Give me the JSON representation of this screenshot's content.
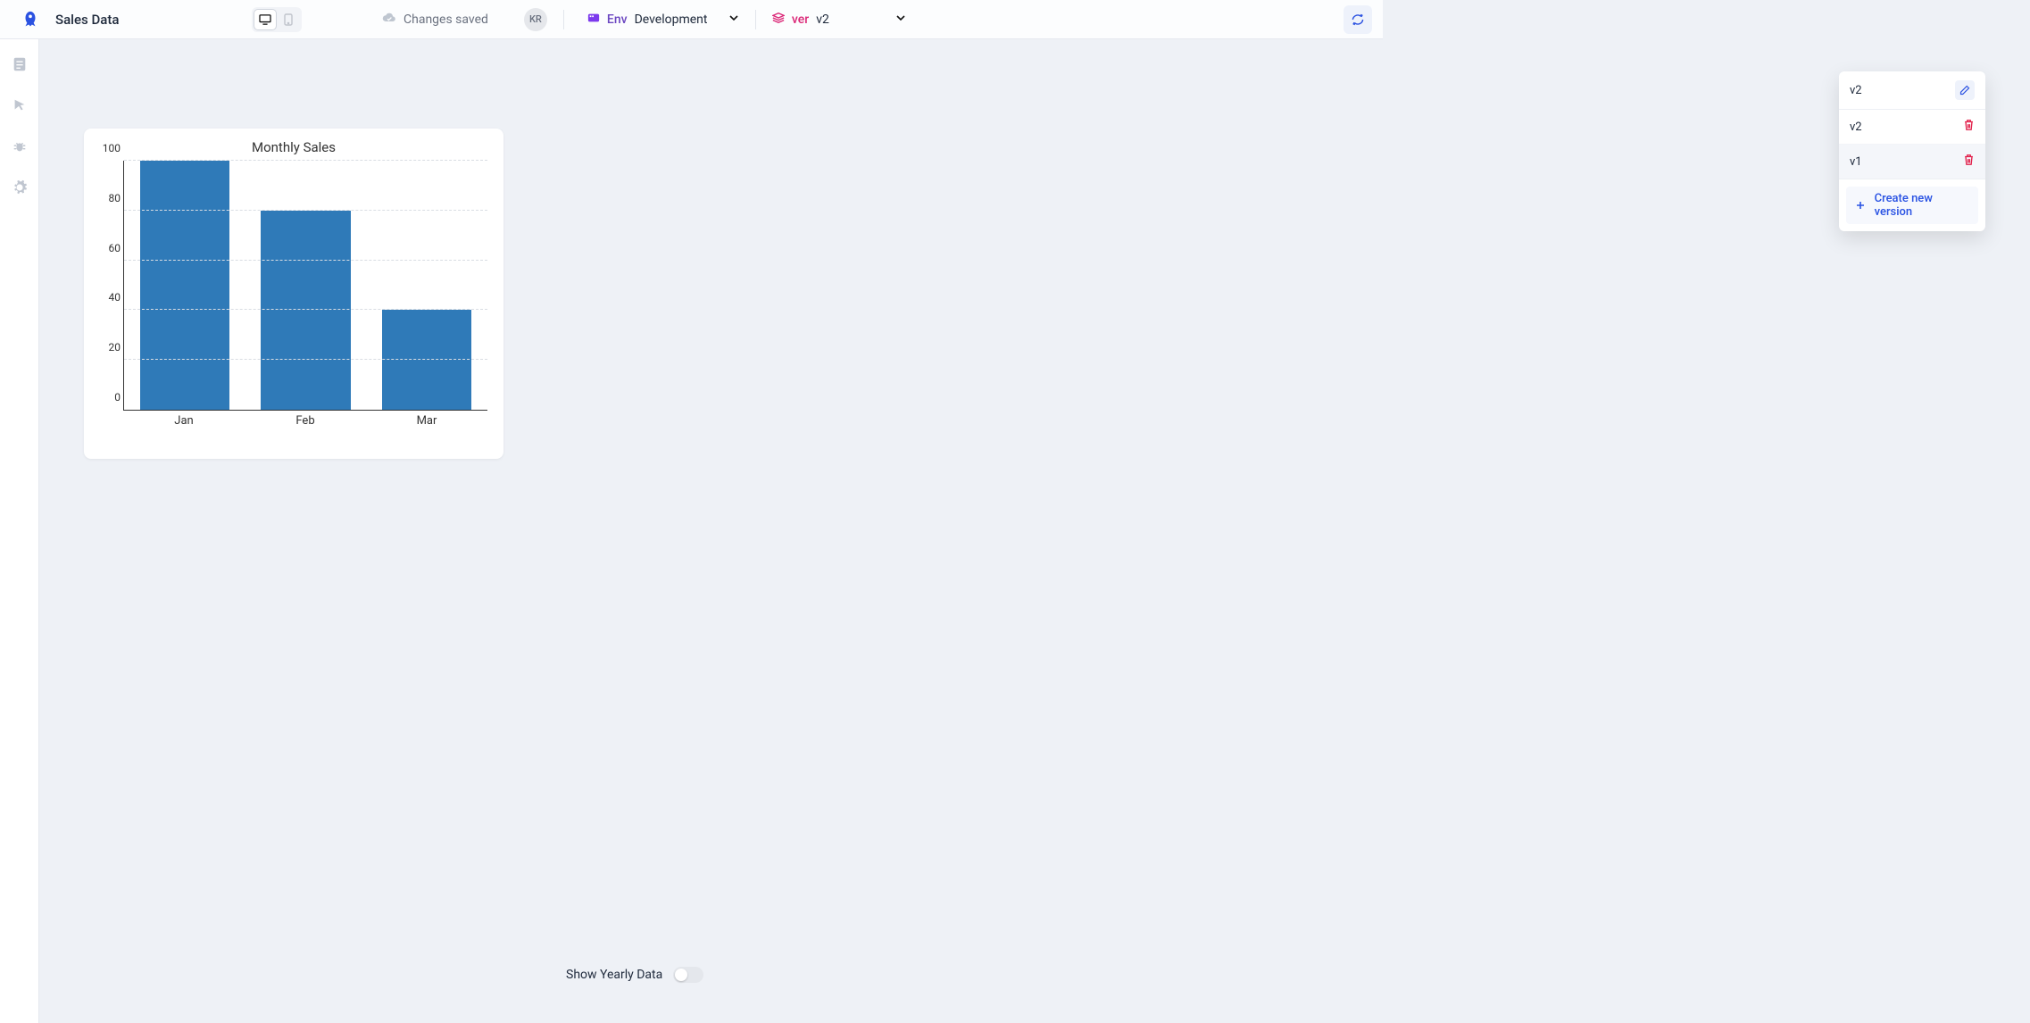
{
  "page_title": "Sales Data",
  "status_text": "Changes saved",
  "avatar_initials": "KR",
  "env": {
    "label": "Env",
    "value": "Development"
  },
  "ver": {
    "label": "ver",
    "value": "v2"
  },
  "version_dropdown": {
    "current": "v2",
    "items": [
      "v2",
      "v1"
    ],
    "create_label": "Create new version"
  },
  "toggle_label": "Show Yearly Data",
  "chart_data": {
    "type": "bar",
    "title": "Monthly Sales",
    "categories": [
      "Jan",
      "Feb",
      "Mar"
    ],
    "values": [
      100,
      80,
      40
    ],
    "ylim": [
      0,
      100
    ],
    "yticks": [
      0,
      20,
      40,
      60,
      80,
      100
    ],
    "bar_color": "#2f7ab8"
  }
}
